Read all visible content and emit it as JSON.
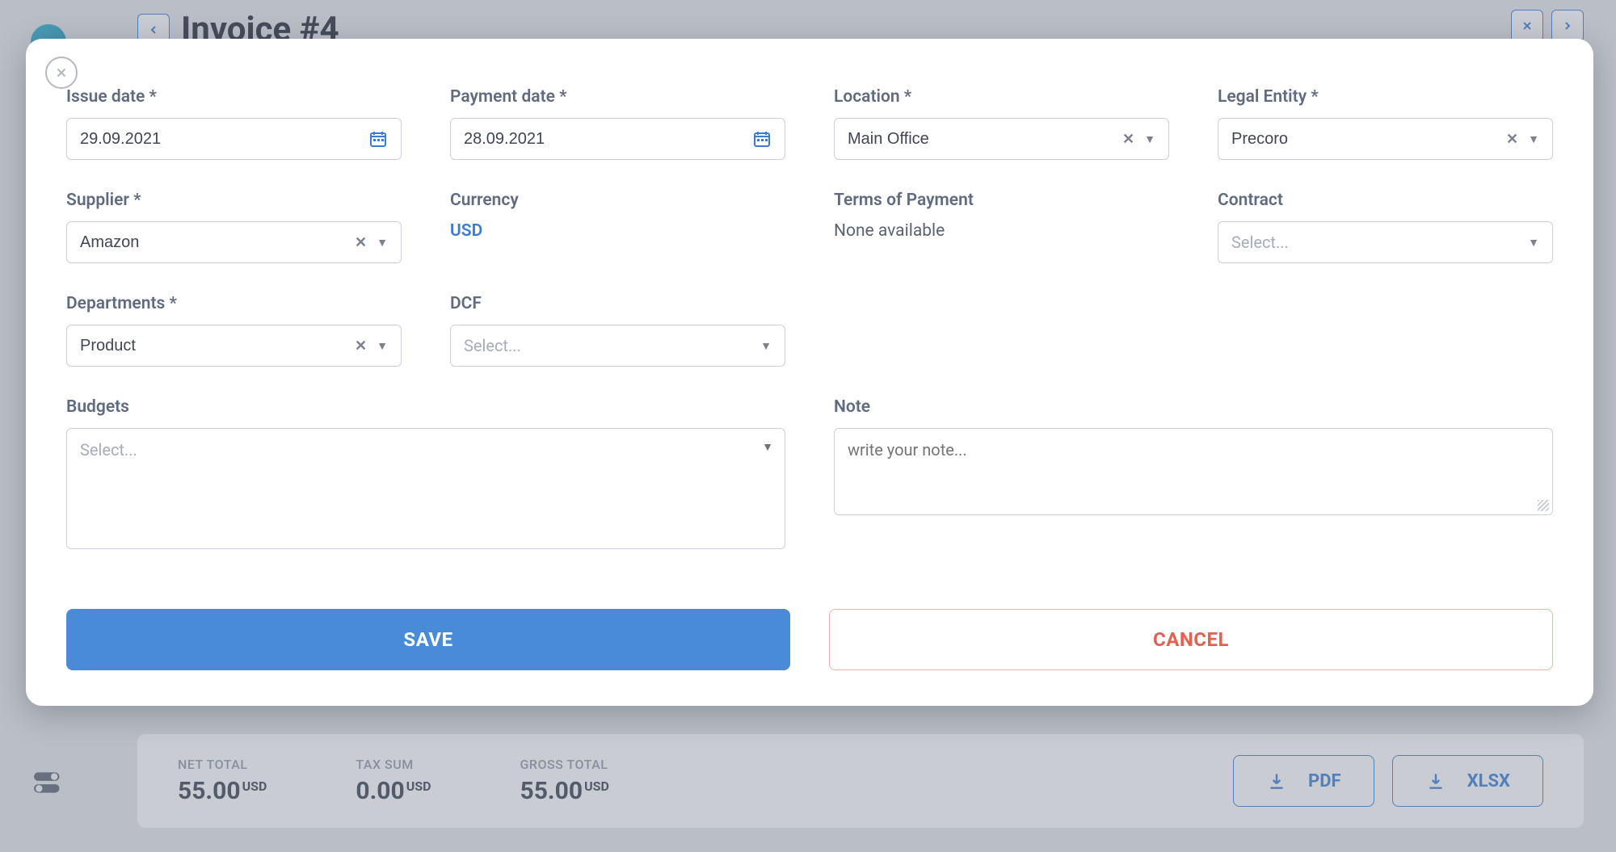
{
  "header": {
    "title": "Invoice #4"
  },
  "modal": {
    "issue_date": {
      "label": "Issue date *",
      "value": "29.09.2021"
    },
    "payment_date": {
      "label": "Payment date *",
      "value": "28.09.2021"
    },
    "location": {
      "label": "Location *",
      "value": "Main Office"
    },
    "legal_entity": {
      "label": "Legal Entity *",
      "value": "Precoro"
    },
    "supplier": {
      "label": "Supplier *",
      "value": "Amazon"
    },
    "currency": {
      "label": "Currency",
      "value": "USD"
    },
    "terms_of_payment": {
      "label": "Terms of Payment",
      "value": "None available"
    },
    "contract": {
      "label": "Contract",
      "placeholder": "Select..."
    },
    "departments": {
      "label": "Departments *",
      "value": "Product"
    },
    "dcf": {
      "label": "DCF",
      "placeholder": "Select..."
    },
    "budgets": {
      "label": "Budgets",
      "placeholder": "Select..."
    },
    "note": {
      "label": "Note",
      "placeholder": "write your note..."
    },
    "buttons": {
      "save": "SAVE",
      "cancel": "CANCEL"
    }
  },
  "totals": {
    "net": {
      "label": "NET TOTAL",
      "value": "55.00",
      "currency": "USD"
    },
    "tax": {
      "label": "TAX SUM",
      "value": "0.00",
      "currency": "USD"
    },
    "gross": {
      "label": "GROSS TOTAL",
      "value": "55.00",
      "currency": "USD"
    }
  },
  "export": {
    "pdf": "PDF",
    "xlsx": "XLSX"
  }
}
